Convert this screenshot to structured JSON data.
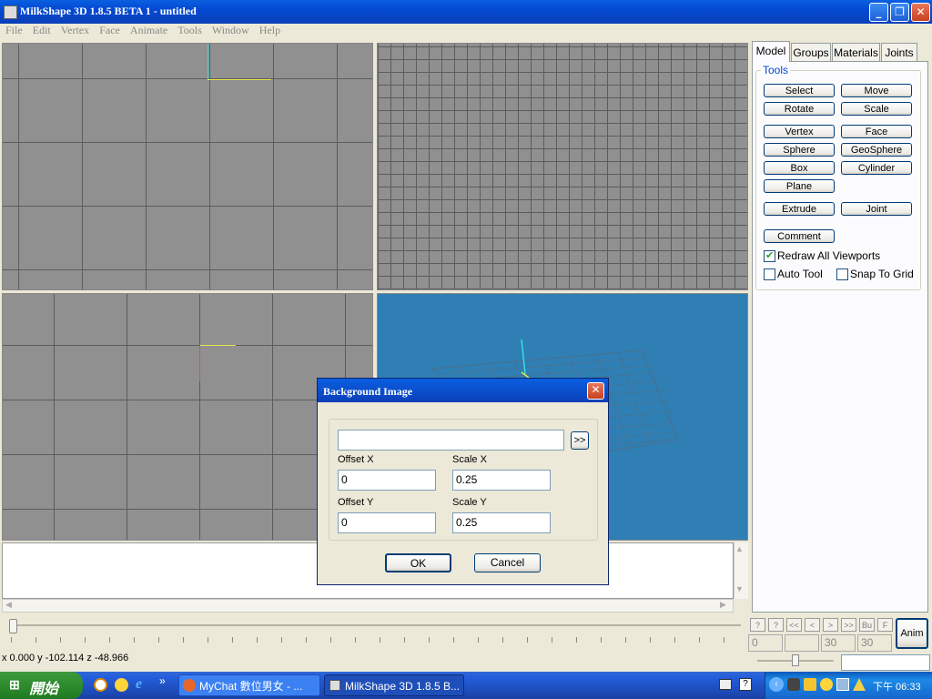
{
  "window": {
    "title": "MilkShape 3D 1.8.5 BETA 1 - untitled"
  },
  "menu": [
    "File",
    "Edit",
    "Vertex",
    "Face",
    "Animate",
    "Tools",
    "Window",
    "Help"
  ],
  "tabs": [
    "Model",
    "Groups",
    "Materials",
    "Joints"
  ],
  "tools_group": "Tools",
  "tools": {
    "select": "Select",
    "move": "Move",
    "rotate": "Rotate",
    "scale": "Scale",
    "vertex": "Vertex",
    "face": "Face",
    "sphere": "Sphere",
    "geosphere": "GeoSphere",
    "box": "Box",
    "cylinder": "Cylinder",
    "plane": "Plane",
    "extrude": "Extrude",
    "joint": "Joint",
    "comment": "Comment"
  },
  "options": {
    "redraw": "Redraw All Viewports",
    "redraw_checked": true,
    "auto_tool": "Auto Tool",
    "snap": "Snap To Grid"
  },
  "dialog": {
    "title": "Background Image",
    "path_value": "",
    "browse": ">>",
    "offset_x_label": "Offset X",
    "offset_x": "0",
    "scale_x_label": "Scale X",
    "scale_x": "0.25",
    "offset_y_label": "Offset Y",
    "offset_y": "0",
    "scale_y_label": "Scale Y",
    "scale_y": "0.25",
    "ok": "OK",
    "cancel": "Cancel"
  },
  "anim": {
    "button": "Anim",
    "frame": "0",
    "end1": "30",
    "end2": "30",
    "small_buttons": [
      "?",
      "?",
      "<<",
      "<",
      ">",
      ">>",
      "Bu",
      "F"
    ]
  },
  "status": "x 0.000 y -102.114 z -48.966",
  "taskbar": {
    "start": "開始",
    "tasks": [
      "MyChat 數位男女 - ...",
      "MilkShape 3D 1.8.5 B..."
    ],
    "clock": "下午 06:33"
  },
  "colors": {
    "viewport_gray": "#909090",
    "viewport_3d": "#2f7fb5",
    "axis_cyan": "#33dddd",
    "axis_yellow": "#e6e64c",
    "axis_magenta": "#d040c0"
  }
}
